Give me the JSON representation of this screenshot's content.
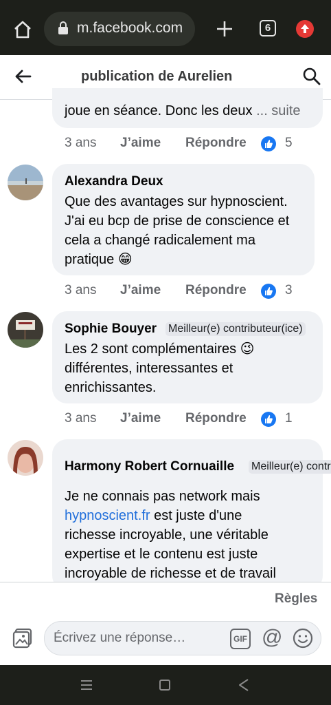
{
  "browser": {
    "url": "m.facebook.com",
    "tab_count": "6"
  },
  "header": {
    "title": "publication de Aurelien"
  },
  "comments": [
    {
      "text_tail": "joue en séance. Donc les deux",
      "see_more": "... suite",
      "time": "3 ans",
      "like": "J’aime",
      "reply": "Répondre",
      "likes": "5"
    },
    {
      "author": "Alexandra Deux",
      "lines": [
        "Que des avantages sur hypnoscient.",
        "J'ai eu bcp de prise de conscience et",
        "cela a changé radicalement ma",
        "pratique 😁"
      ],
      "time": "3 ans",
      "like": "J’aime",
      "reply": "Répondre",
      "likes": "3"
    },
    {
      "author": "Sophie Bouyer",
      "badge": "Meilleur(e) contributeur(ice)",
      "lines": [
        "Les 2 sont complémentaires 😉",
        "différentes, interessantes et",
        "enrichissantes."
      ],
      "time": "3 ans",
      "like": "J’aime",
      "reply": "Répondre",
      "likes": "1"
    },
    {
      "author": "Harmony Robert Cornuaille",
      "badge": "Meilleur(e) contr",
      "line1": "Je ne connais pas network mais",
      "link": "hypnoscient.fr",
      "line2_rest": " est juste d'une",
      "line3": "richesse incroyable, une véritable",
      "line4": "expertise et le contenu est juste",
      "line5": "incroyable de richesse et de travail"
    }
  ],
  "composer": {
    "rules": "Règles",
    "placeholder": "Écrivez une réponse…",
    "gif": "GIF"
  },
  "icons": [
    "home-icon",
    "lock-icon",
    "plus-icon",
    "tabs-icon",
    "update-icon",
    "back-arrow-icon",
    "search-icon",
    "like-icon",
    "photo-icon",
    "gif-icon",
    "at-icon",
    "smiley-icon",
    "menu-icon",
    "square-icon",
    "triangle-back-icon"
  ],
  "colors": {
    "accent": "#1877f2",
    "link": "#216fdb",
    "bubble": "#f0f2f5"
  }
}
